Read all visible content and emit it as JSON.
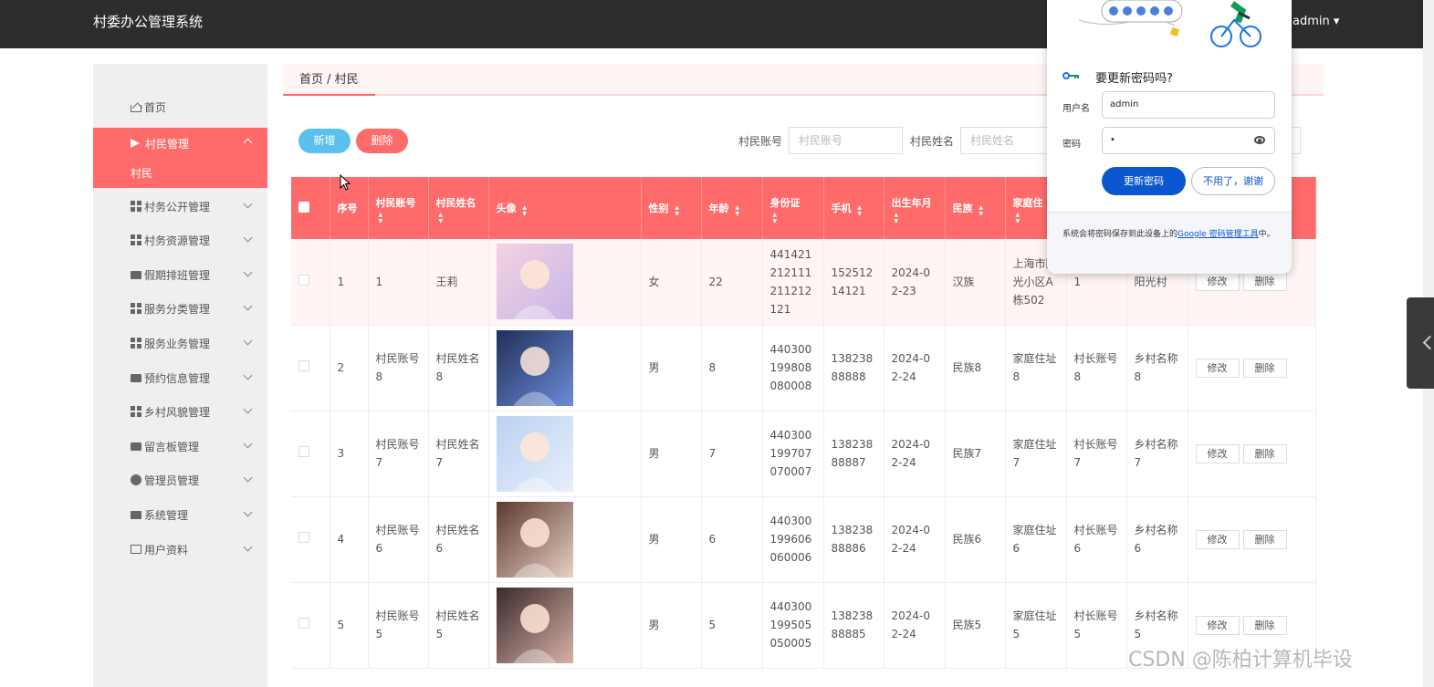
{
  "topbar": {
    "title": "村委办公管理系统",
    "user": "admin ▾"
  },
  "sidebar": {
    "home": "首页",
    "villager_mgmt": "村民管理",
    "villager_sub": "村民",
    "items": [
      "村务公开管理",
      "村务资源管理",
      "假期排班管理",
      "服务分类管理",
      "服务业务管理",
      "预约信息管理",
      "乡村风貌管理",
      "留言板管理",
      "管理员管理",
      "系统管理",
      "用户资料"
    ]
  },
  "breadcrumb": "首页 / 村民",
  "toolbar": {
    "add": "新增",
    "delete": "删除",
    "account_label": "村民账号",
    "account_placeholder": "村民账号",
    "name_label": "村民姓名",
    "name_placeholder": "村民姓名"
  },
  "table": {
    "headers": [
      "序号",
      "村民账号",
      "村民姓名",
      "头像",
      "性别",
      "年龄",
      "身份证",
      "手机",
      "出生年月",
      "民族",
      "家庭住"
    ],
    "rows": [
      {
        "no": "1",
        "account": "1",
        "name": "王莉",
        "gender": "女",
        "age": "22",
        "idcard": "441421212111211212121",
        "phone": "15251214121",
        "birth": "2024-02-23",
        "ethnic": "汉族",
        "address": "上海市阳光小区A栋502",
        "head": "1",
        "village": "阳光村"
      },
      {
        "no": "2",
        "account": "村民账号8",
        "name": "村民姓名8",
        "gender": "男",
        "age": "8",
        "idcard": "440300199808080008",
        "phone": "13823888888",
        "birth": "2024-02-24",
        "ethnic": "民族8",
        "address": "家庭住址8",
        "head": "村长账号8",
        "village": "乡村名称8"
      },
      {
        "no": "3",
        "account": "村民账号7",
        "name": "村民姓名7",
        "gender": "男",
        "age": "7",
        "idcard": "440300199707070007",
        "phone": "13823888887",
        "birth": "2024-02-24",
        "ethnic": "民族7",
        "address": "家庭住址7",
        "head": "村长账号7",
        "village": "乡村名称7"
      },
      {
        "no": "4",
        "account": "村民账号6",
        "name": "村民姓名6",
        "gender": "男",
        "age": "6",
        "idcard": "440300199606060006",
        "phone": "13823888886",
        "birth": "2024-02-24",
        "ethnic": "民族6",
        "address": "家庭住址6",
        "head": "村长账号6",
        "village": "乡村名称6"
      },
      {
        "no": "5",
        "account": "村民账号5",
        "name": "村民姓名5",
        "gender": "男",
        "age": "5",
        "idcard": "440300199505050005",
        "phone": "13823888885",
        "birth": "2024-02-24",
        "ethnic": "民族5",
        "address": "家庭住址5",
        "head": "村长账号5",
        "village": "乡村名称5"
      }
    ],
    "edit": "修改",
    "remove": "删除"
  },
  "password_popup": {
    "title": "要更新密码吗?",
    "username_label": "用户名",
    "username_value": "admin",
    "password_label": "密码",
    "password_value": "•",
    "update": "更新密码",
    "no_thanks": "不用了，谢谢",
    "footer_prefix": "系统会将密码保存到此设备上的",
    "footer_link": "Google 密码管理工具",
    "footer_suffix": "中。"
  },
  "watermark": "CSDN @陈柏计算机毕设",
  "colors": {
    "accent": "#ff6b6b",
    "add_button": "#5bc0eb",
    "popup_primary": "#0b57d0",
    "topbar": "#2d2d2d"
  }
}
